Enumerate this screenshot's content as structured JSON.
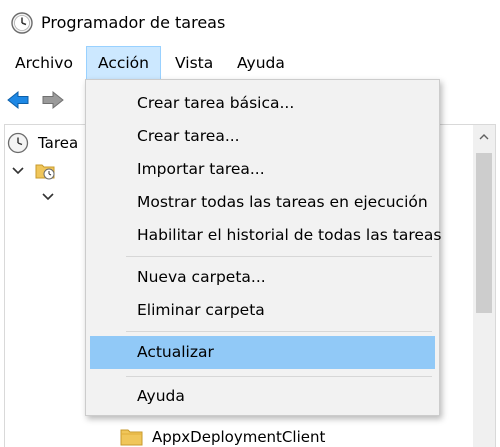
{
  "window": {
    "title": "Programador de tareas"
  },
  "menubar": {
    "items": [
      {
        "label": "Archivo"
      },
      {
        "label": "Acción"
      },
      {
        "label": "Vista"
      },
      {
        "label": "Ayuda"
      }
    ],
    "active_index": 1
  },
  "toolbar": {
    "back_icon": "back-arrow-icon",
    "forward_icon": "forward-arrow-icon"
  },
  "tree": {
    "root_label": "Tarea",
    "visible_folder_label": "AppxDeploymentClient"
  },
  "dropdown": {
    "items": [
      {
        "label": "Crear tarea básica..."
      },
      {
        "label": "Crear tarea..."
      },
      {
        "label": "Importar tarea..."
      },
      {
        "label": "Mostrar todas las tareas en ejecución"
      },
      {
        "label": "Habilitar el historial de todas las tareas"
      },
      {
        "label": "Nueva carpeta..."
      },
      {
        "label": "Eliminar carpeta"
      },
      {
        "label": "Actualizar"
      },
      {
        "label": "Ayuda"
      }
    ],
    "highlighted_index": 7
  },
  "colors": {
    "menu_active_bg": "#cce8ff",
    "dropdown_bg": "#f2f2f2",
    "dropdown_hover": "#91c9f7",
    "arrow_blue": "#1e88e5"
  }
}
